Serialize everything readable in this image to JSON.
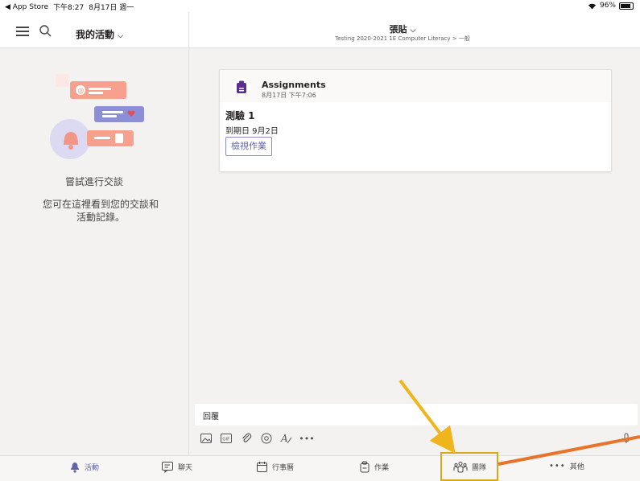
{
  "status_bar": {
    "back_app": "◀ App Store",
    "time": "下午8:27",
    "date": "8月17日 週一",
    "battery": "96%"
  },
  "left_pane": {
    "title": "我的活動",
    "empty_title": "嘗試進行交談",
    "empty_body": "您可在這裡看到您的交談和活動記錄。"
  },
  "channel": {
    "name": "張貼",
    "path": "Testing 2020-2021 1E Computer Literacy > 一般"
  },
  "post": {
    "app_name": "Assignments",
    "timestamp": "8月17日 下午7:06",
    "title": "測驗 1",
    "due": "到期日 9月2日",
    "button": "檢視作業"
  },
  "reply": {
    "label": "回覆"
  },
  "bottom_tabs": [
    {
      "label": "活動",
      "icon": "bell-icon",
      "active": true
    },
    {
      "label": "聊天",
      "icon": "chat-icon",
      "active": false
    },
    {
      "label": "行事曆",
      "icon": "calendar-icon",
      "active": false
    },
    {
      "label": "作業",
      "icon": "assignments-icon",
      "active": false
    },
    {
      "label": "團隊",
      "icon": "teams-icon",
      "active": false
    },
    {
      "label": "其他",
      "icon": "more-icon",
      "active": false
    }
  ],
  "colors": {
    "accent": "#6264a7",
    "highlight_box": "#d4a91b",
    "arrow_yellow": "#f0b51c",
    "arrow_orange": "#e8732a"
  }
}
